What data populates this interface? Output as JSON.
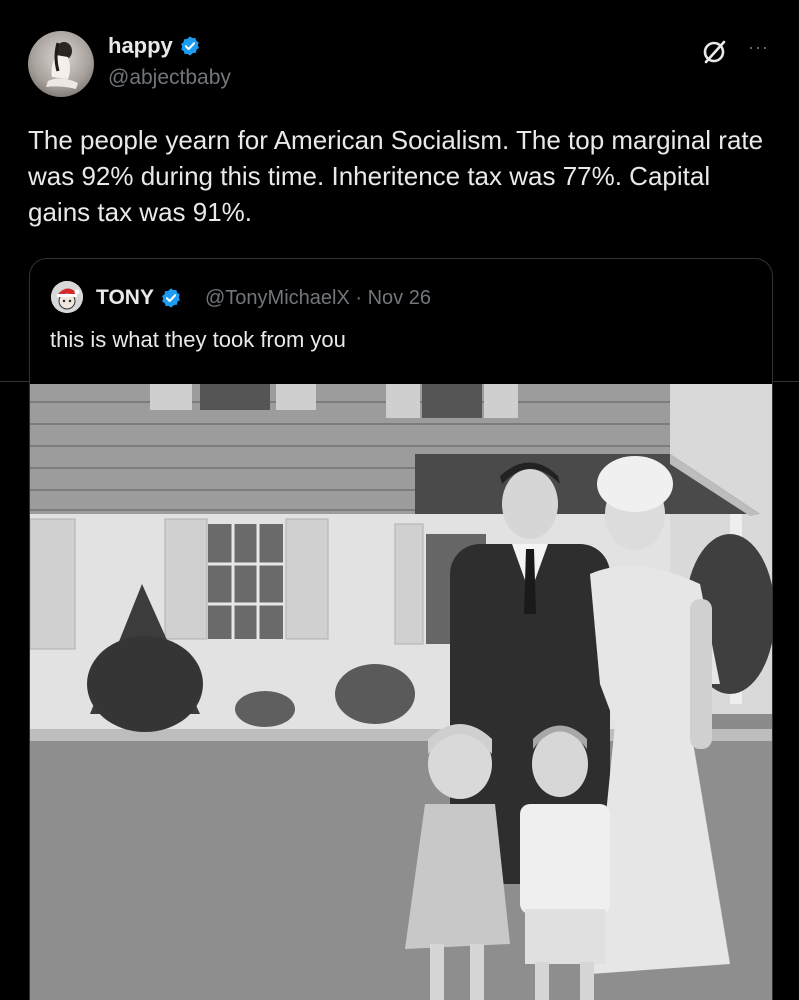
{
  "post": {
    "author": {
      "display_name": "happy",
      "handle": "@abjectbaby",
      "verified": true
    },
    "text": "The people yearn for American Socialism. The top marginal rate was 92% during this time. Inheritence tax was 77%. Capital gains tax was 91%.",
    "icons": {
      "grok": "grok-icon",
      "more": "more-options-icon"
    },
    "more_label": "···"
  },
  "quote": {
    "author": {
      "display_name": "TONY",
      "handle": "@TonyMichaelX",
      "verified": true
    },
    "separator": "·",
    "date": "Nov 26",
    "text": "this is what they took from you",
    "media": {
      "type": "photo",
      "description_icon": "image-icon"
    }
  },
  "colors": {
    "background": "#000000",
    "text_primary": "#e7e9ea",
    "text_secondary": "#71767b",
    "verified_blue": "#1d9bf0",
    "border": "#2f3336"
  }
}
